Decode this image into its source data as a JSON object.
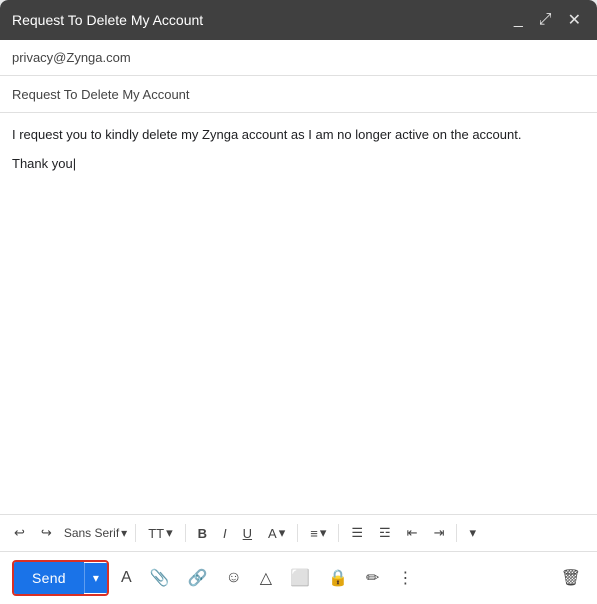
{
  "window": {
    "title": "Request To Delete My Account",
    "header_icons": [
      "minimize",
      "expand",
      "close"
    ]
  },
  "fields": {
    "to": "privacy@Zynga.com",
    "subject": "Request To Delete My Account"
  },
  "body": {
    "line1": "I request you to kindly delete my Zynga account as I am no longer active on the account.",
    "line2": "Thank you"
  },
  "toolbar": {
    "undo": "↩",
    "redo": "↪",
    "font_family": "Sans Serif",
    "font_size_label": "TT",
    "bold": "B",
    "italic": "I",
    "underline": "U",
    "font_color": "A",
    "align": "≡",
    "numbered_list": "ol",
    "bullet_list": "ul",
    "indent_less": "⇤",
    "indent_more": "⇥",
    "more": "⋮"
  },
  "bottom_toolbar": {
    "send_label": "Send",
    "send_dropdown_label": "▾",
    "icons": [
      "A",
      "📎",
      "🔗",
      "😊",
      "△",
      "🖼",
      "🔒",
      "✏",
      "⋮"
    ],
    "trash_label": "🗑"
  },
  "colors": {
    "send_bg": "#1a73e8",
    "send_border": "#d93025",
    "header_bg": "#404040"
  }
}
